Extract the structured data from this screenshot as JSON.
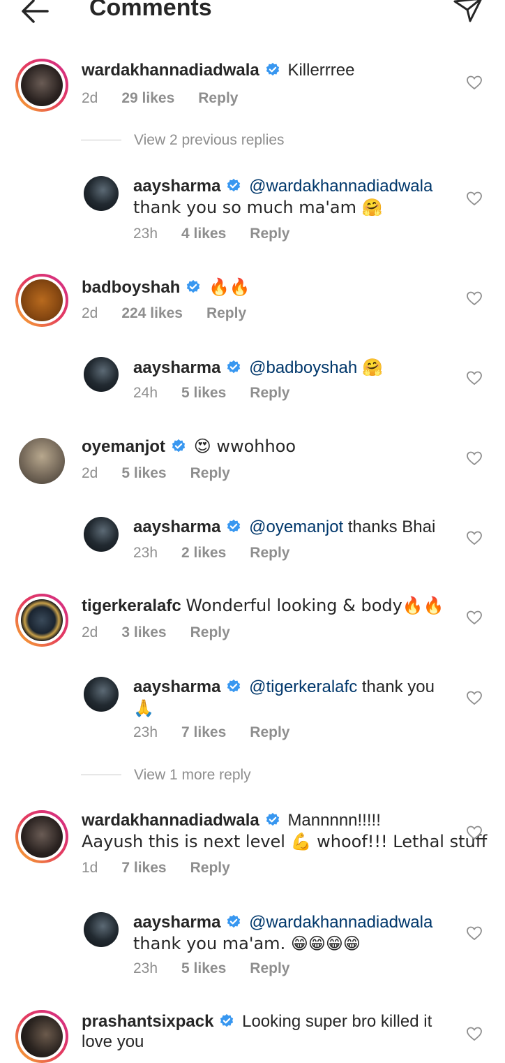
{
  "header": {
    "title": "Comments"
  },
  "view_more": [
    {
      "label": "View 2 previous replies"
    },
    {
      "label": "View 1 more reply"
    }
  ],
  "comments": [
    {
      "user": "wardakhannadiadwala",
      "text": "Killerrree",
      "time": "2d",
      "likes": "29 likes",
      "reply": "Reply"
    },
    {
      "user": "aaysharma",
      "mention": "@wardakhannadiadwala",
      "text": "thank you so much ma'am 🤗",
      "time": "23h",
      "likes": "4 likes",
      "reply": "Reply"
    },
    {
      "user": "badboyshah",
      "text": "🔥🔥",
      "time": "2d",
      "likes": "224 likes",
      "reply": "Reply"
    },
    {
      "user": "aaysharma",
      "mention": "@badboyshah",
      "text": "🤗",
      "time": "24h",
      "likes": "5 likes",
      "reply": "Reply"
    },
    {
      "user": "oyemanjot",
      "text": "😍 wwohhoo",
      "time": "2d",
      "likes": "5 likes",
      "reply": "Reply"
    },
    {
      "user": "aaysharma",
      "mention": "@oyemanjot",
      "text": "thanks Bhai",
      "time": "23h",
      "likes": "2 likes",
      "reply": "Reply"
    },
    {
      "user": "tigerkeralafc",
      "text": "Wonderful looking & body🔥🔥",
      "time": "2d",
      "likes": "3 likes",
      "reply": "Reply"
    },
    {
      "user": "aaysharma",
      "mention": "@tigerkeralafc",
      "text": "thank you",
      "text2": "🙏",
      "time": "23h",
      "likes": "7 likes",
      "reply": "Reply"
    },
    {
      "user": "wardakhannadiadwala",
      "text": "Mannnnn!!!!!",
      "text2": "Aayush this is next level 💪 whoof!!! Lethal stuff",
      "time": "1d",
      "likes": "7 likes",
      "reply": "Reply"
    },
    {
      "user": "aaysharma",
      "mention": "@wardakhannadiadwala",
      "text": "thank you ma'am. 😁😁😁😁",
      "time": "23h",
      "likes": "5 likes",
      "reply": "Reply"
    },
    {
      "user": "prashantsixpack",
      "text": "Looking super bro killed it",
      "text2": "love you"
    }
  ],
  "colors": {
    "verified": "#3897f0",
    "mention": "#00376b",
    "meta": "#8e8e8e"
  },
  "icons": {
    "back": "arrow-left-icon",
    "send": "paper-plane-icon",
    "like": "heart-outline-icon",
    "verified": "verified-badge-icon"
  }
}
